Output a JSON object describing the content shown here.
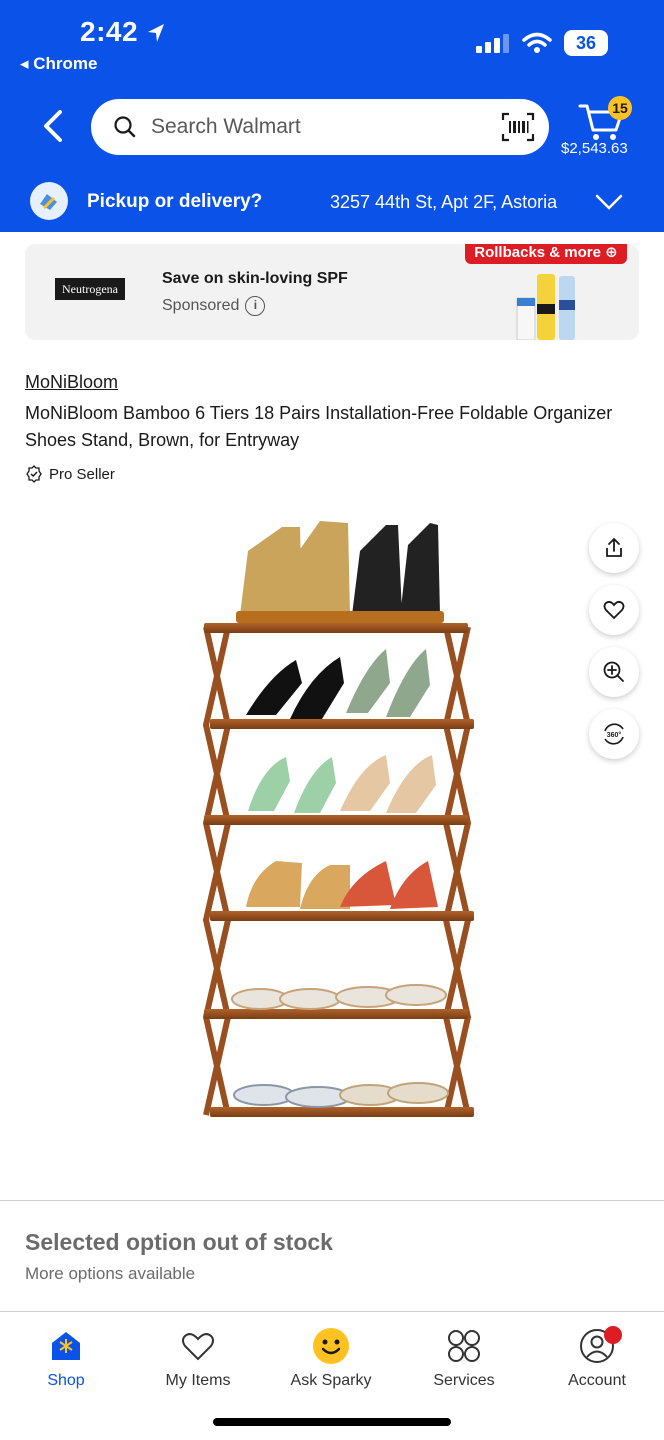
{
  "status_bar": {
    "time": "2:42",
    "back_app": "Chrome",
    "battery": "36"
  },
  "header": {
    "search_placeholder": "Search Walmart",
    "cart_count": "15",
    "cart_total": "$2,543.63",
    "pickup_label": "Pickup or delivery?",
    "address": "3257 44th St, Apt 2F, Astoria"
  },
  "ad": {
    "logo": "Neutrogena",
    "title": "Save on skin-loving SPF",
    "sponsored": "Sponsored",
    "banner": "Rollbacks & more"
  },
  "product": {
    "brand": "MoNiBloom",
    "title": "MoNiBloom Bamboo 6 Tiers 18 Pairs Installation-Free Foldable Organizer Shoes Stand, Brown, for Entryway",
    "seller_badge": "Pro Seller"
  },
  "stock": {
    "title": "Selected option out of stock",
    "subtitle": "More options available"
  },
  "nav": {
    "items": [
      {
        "label": "Shop",
        "icon": "shop-icon"
      },
      {
        "label": "My Items",
        "icon": "heart-icon"
      },
      {
        "label": "Ask Sparky",
        "icon": "sparky-icon"
      },
      {
        "label": "Services",
        "icon": "services-icon"
      },
      {
        "label": "Account",
        "icon": "account-icon"
      }
    ]
  },
  "colors": {
    "brand_blue": "#0a52e8",
    "badge_yellow": "#ffc220",
    "rollback_red": "#de1c24"
  }
}
